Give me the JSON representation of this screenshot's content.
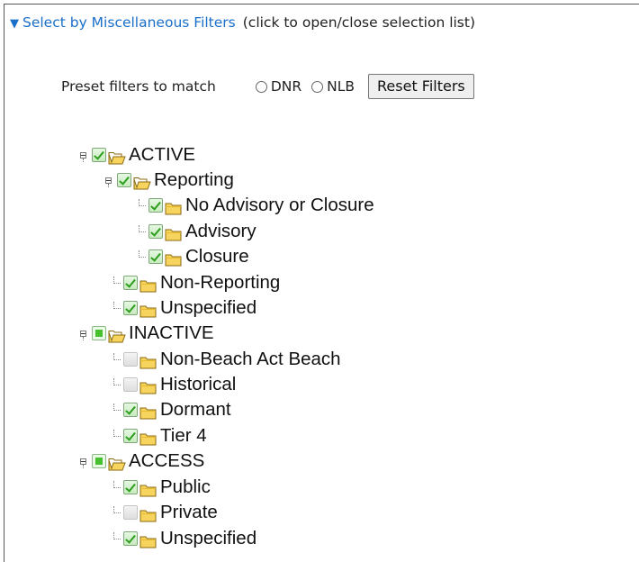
{
  "header": {
    "arrow": "▼",
    "title": "Select by Miscellaneous Filters",
    "hint": "(click to open/close selection list)"
  },
  "preset": {
    "label": "Preset filters to match",
    "radio_dnr": "DNR",
    "radio_nlb": "NLB",
    "reset_label": "Reset Filters"
  },
  "tree": [
    {
      "label": "ACTIVE",
      "state": "checked",
      "expanded": true
    },
    {
      "label": "Reporting",
      "state": "checked",
      "expanded": true
    },
    {
      "label": "No Advisory or Closure",
      "state": "checked"
    },
    {
      "label": "Advisory",
      "state": "checked"
    },
    {
      "label": "Closure",
      "state": "checked"
    },
    {
      "label": "Non-Reporting",
      "state": "checked"
    },
    {
      "label": "Unspecified",
      "state": "checked"
    },
    {
      "label": "INACTIVE",
      "state": "partial",
      "expanded": true
    },
    {
      "label": "Non-Beach Act Beach",
      "state": "unchecked"
    },
    {
      "label": "Historical",
      "state": "unchecked"
    },
    {
      "label": "Dormant",
      "state": "checked"
    },
    {
      "label": "Tier 4",
      "state": "checked"
    },
    {
      "label": "ACCESS",
      "state": "partial",
      "expanded": true
    },
    {
      "label": "Public",
      "state": "checked"
    },
    {
      "label": "Private",
      "state": "unchecked"
    },
    {
      "label": "Unspecified",
      "state": "checked"
    }
  ]
}
